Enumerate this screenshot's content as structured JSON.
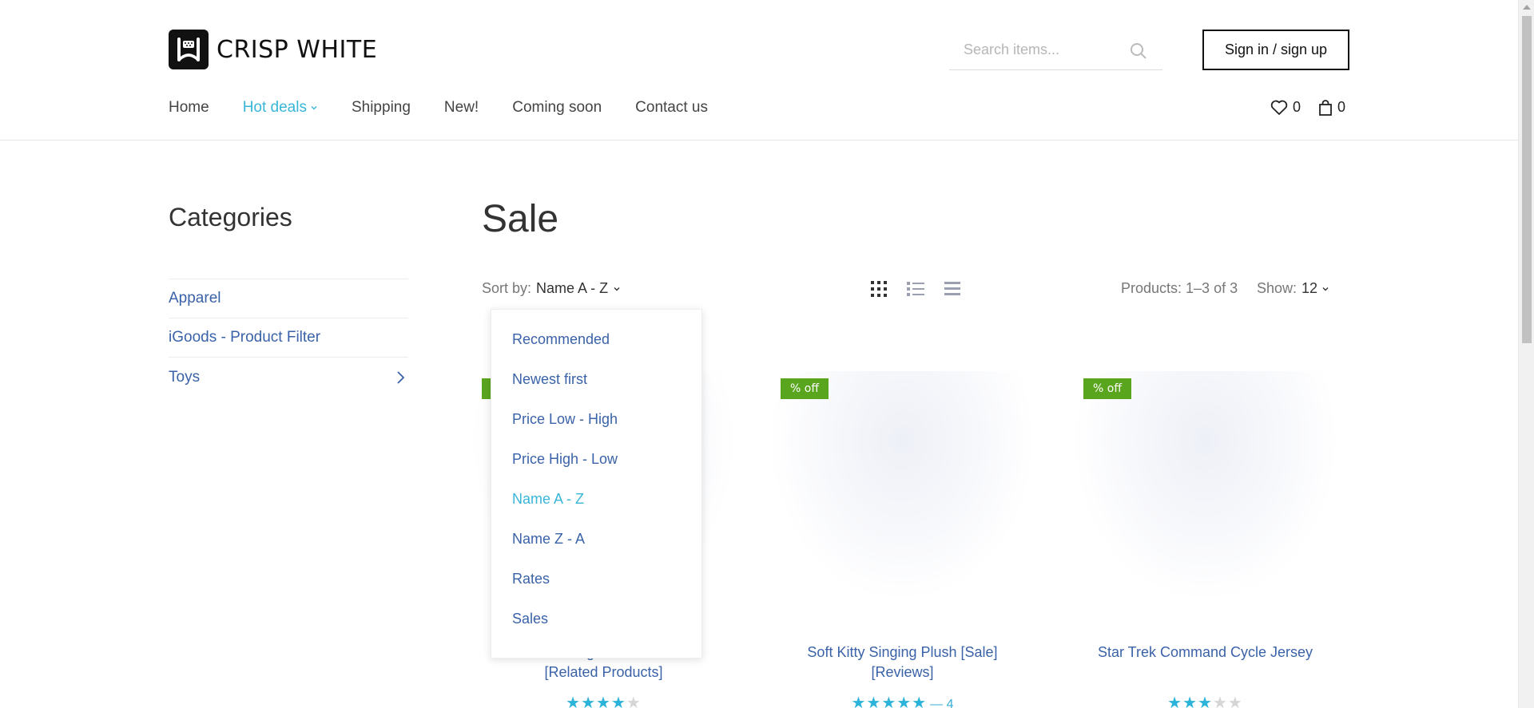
{
  "brand": {
    "name": "CRISP WHITE"
  },
  "search": {
    "placeholder": "Search items..."
  },
  "auth": {
    "signin_label": "Sign in / sign up"
  },
  "nav": {
    "items": [
      "Home",
      "Hot deals",
      "Shipping",
      "New!",
      "Coming soon",
      "Contact us"
    ],
    "active": "Hot deals"
  },
  "counters": {
    "wishlist": "0",
    "cart": "0"
  },
  "sidebar": {
    "title": "Categories",
    "items": [
      "Apparel",
      "iGoods - Product Filter",
      "Toys"
    ]
  },
  "main": {
    "title": "Sale",
    "sort_label": "Sort by:",
    "sort_value": "Name A - Z",
    "products_count": "Products: 1–3 of 3",
    "show_label": "Show:",
    "show_value": "12"
  },
  "sort_options": [
    "Recommended",
    "Newest first",
    "Price Low - High",
    "Price High - Low",
    "Name A - Z",
    "Name Z - A",
    "Rates",
    "Sales"
  ],
  "products": [
    {
      "badge": "% off",
      "name_line1": "…g… …h",
      "name_line2": "[Related Products]",
      "rating": 4,
      "reviews": ""
    },
    {
      "badge": "% off",
      "name_line1": "Soft Kitty Singing Plush [Sale]",
      "name_line2": "[Reviews]",
      "rating": 5,
      "reviews": "— 4"
    },
    {
      "badge": "% off",
      "name_line1": "Star Trek Command Cycle Jersey",
      "name_line2": "",
      "rating": 3,
      "reviews": ""
    }
  ],
  "colors": {
    "accent": "#38b6d8",
    "link": "#3a62a8",
    "badge": "#5aa51e",
    "star": "#2bb3d9"
  }
}
